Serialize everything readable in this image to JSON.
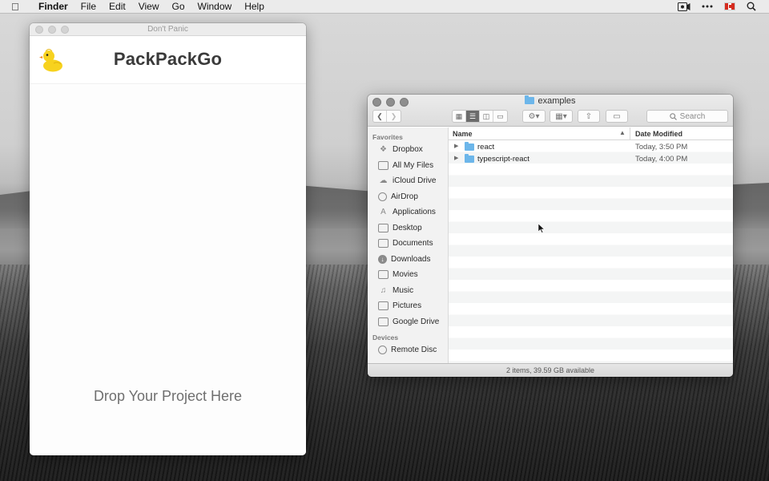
{
  "menubar": {
    "app_name": "Finder",
    "items": [
      "File",
      "Edit",
      "View",
      "Go",
      "Window",
      "Help"
    ]
  },
  "packpackgo": {
    "window_title": "Don't Panic",
    "brand": "PackPackGo",
    "drop_text": "Drop Your Project Here"
  },
  "finder": {
    "window_title": "examples",
    "search_placeholder": "Search",
    "sidebar": {
      "favorites_header": "Favorites",
      "favorites": [
        {
          "label": "Dropbox",
          "icon": "dropbox-icon"
        },
        {
          "label": "All My Files",
          "icon": "all-files-icon"
        },
        {
          "label": "iCloud Drive",
          "icon": "cloud-icon"
        },
        {
          "label": "AirDrop",
          "icon": "airdrop-icon"
        },
        {
          "label": "Applications",
          "icon": "applications-icon"
        },
        {
          "label": "Desktop",
          "icon": "desktop-icon"
        },
        {
          "label": "Documents",
          "icon": "documents-icon"
        },
        {
          "label": "Downloads",
          "icon": "downloads-icon"
        },
        {
          "label": "Movies",
          "icon": "movies-icon"
        },
        {
          "label": "Music",
          "icon": "music-icon"
        },
        {
          "label": "Pictures",
          "icon": "pictures-icon"
        },
        {
          "label": "Google Drive",
          "icon": "folder-icon"
        }
      ],
      "devices_header": "Devices",
      "devices": [
        {
          "label": "Remote Disc",
          "icon": "disc-icon"
        }
      ]
    },
    "columns": {
      "name": "Name",
      "date": "Date Modified"
    },
    "rows": [
      {
        "name": "react",
        "date": "Today, 3:50 PM"
      },
      {
        "name": "typescript-react",
        "date": "Today, 4:00 PM"
      }
    ],
    "status": "2 items, 39.59 GB available"
  },
  "colors": {
    "folder_blue": "#6cb6ea",
    "duck_yellow": "#f7d21e"
  }
}
